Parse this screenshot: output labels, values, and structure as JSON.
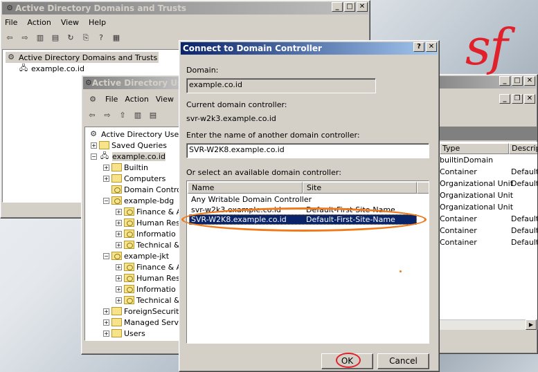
{
  "back_window": {
    "title": "Active Directory Domains and Trusts",
    "menu": [
      "File",
      "Action",
      "View",
      "Help"
    ],
    "tree_root": "Active Directory Domains and Trusts",
    "tree_child": "example.co.id"
  },
  "users_window": {
    "title": "Active Directory Use",
    "menu": [
      "File",
      "Action",
      "View"
    ],
    "tree": [
      "Active Directory Users",
      "Saved Queries",
      "example.co.id",
      "Builtin",
      "Computers",
      "Domain Control",
      "example-bdg",
      "Finance & A",
      "Human Res",
      "Informatio",
      "Technical &",
      "example-jkt",
      "Finance & A",
      "Human Res",
      "Informatio",
      "Technical &",
      "ForeignSecurity",
      "Managed Servi",
      "Users"
    ]
  },
  "right_panel": {
    "columns": [
      "Type",
      "Descrip"
    ],
    "rows": [
      {
        "type": "builtinDomain",
        "desc": ""
      },
      {
        "type": "Container",
        "desc": "Default"
      },
      {
        "type": "Organizational Unit",
        "desc": "Default"
      },
      {
        "type": "Organizational Unit",
        "desc": ""
      },
      {
        "type": "Organizational Unit",
        "desc": ""
      },
      {
        "type": "Container",
        "desc": "Default"
      },
      {
        "type": "Container",
        "desc": "Default"
      },
      {
        "type": "Container",
        "desc": "Default"
      }
    ]
  },
  "dialog": {
    "title": "Connect to Domain Controller",
    "domain_label": "Domain:",
    "domain_value": "example.co.id",
    "current_dc_label": "Current domain controller:",
    "current_dc_value": "svr-w2k3.example.co.id",
    "enter_label": "Enter the name of another domain controller:",
    "enter_value": "SVR-W2K8.example.co.id",
    "select_label": "Or select an available domain controller:",
    "col_name": "Name",
    "col_site": "Site",
    "rows": [
      {
        "name": "Any Writable Domain Controller",
        "site": ""
      },
      {
        "name": "svr-w2k3.example.co.id",
        "site": "Default-First-Site-Name"
      },
      {
        "name": "SVR-W2K8.example.co.id",
        "site": "Default-First-Site-Name"
      }
    ],
    "ok": "OK",
    "cancel": "Cancel"
  },
  "logo": "sf",
  "colors": {
    "highlight": "#0a246a",
    "annotation": "#f07a1a",
    "logo": "#e0202a"
  }
}
